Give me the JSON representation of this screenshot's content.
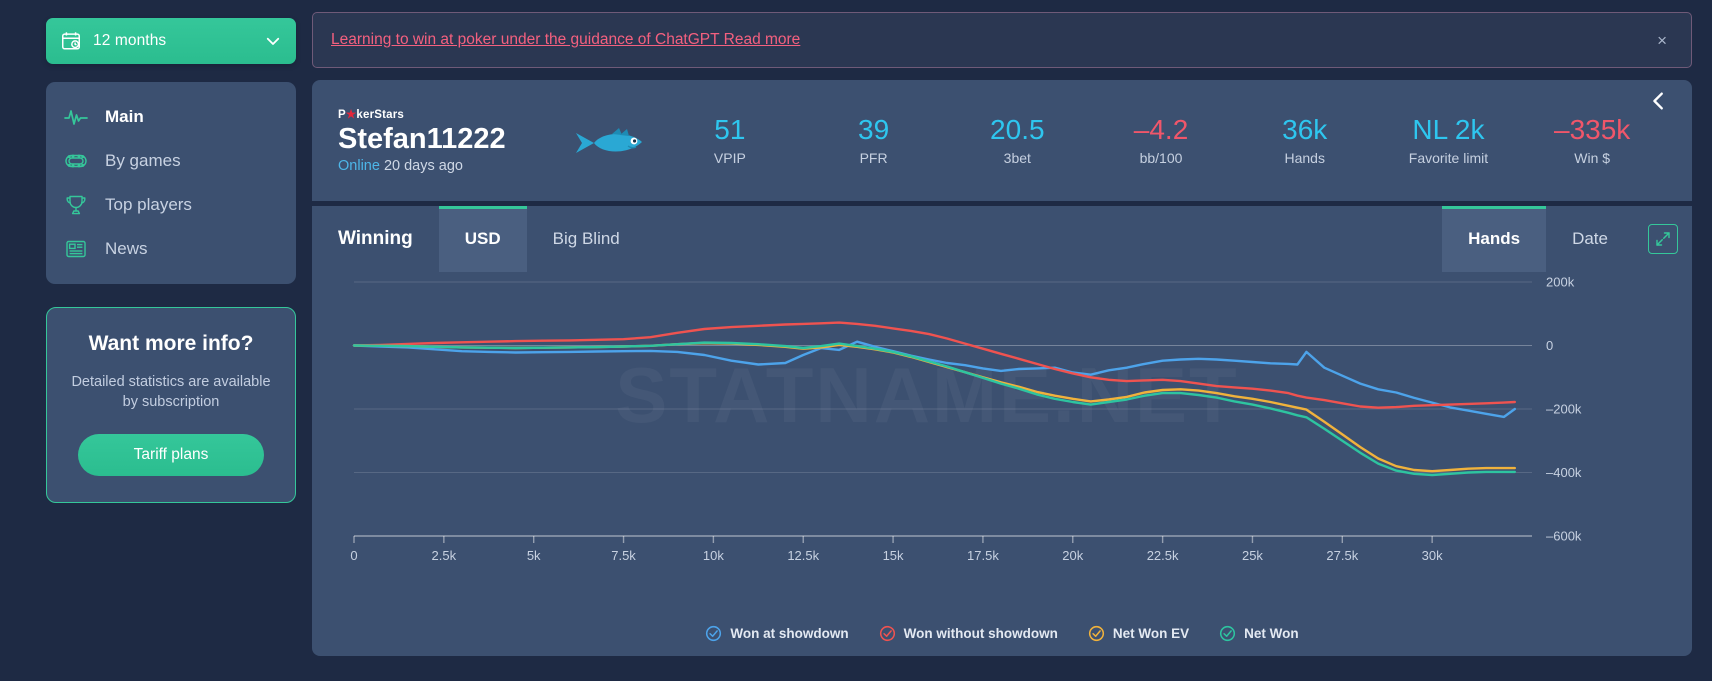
{
  "sidebar": {
    "period_selector": {
      "label": "12 months",
      "icon": "calendar-icon",
      "chevron": "chevron-down-icon"
    },
    "nav": [
      {
        "label": "Main",
        "icon": "pulse-icon",
        "active": true
      },
      {
        "label": "By games",
        "icon": "poker-table-icon",
        "active": false
      },
      {
        "label": "Top players",
        "icon": "trophy-icon",
        "active": false
      },
      {
        "label": "News",
        "icon": "news-icon",
        "active": false
      }
    ],
    "promo": {
      "title": "Want more info?",
      "subtitle": "Detailed statistics are available by subscription",
      "button": "Tariff plans"
    }
  },
  "notice": {
    "link_text": "Learning to win at poker under the guidance of ChatGPT Read more",
    "close": "×",
    "color": "#f4607f"
  },
  "player": {
    "room": "PokerStars",
    "room_prefix": "P",
    "room_suffix": "kerStars",
    "name": "Stefan11222",
    "status_online": "Online",
    "status_rest": "20 days ago",
    "avatar_icon": "fish-icon",
    "collapse_icon": "chevron-left-icon",
    "stats": [
      {
        "value": "51",
        "label": "VPIP",
        "negative": false
      },
      {
        "value": "39",
        "label": "PFR",
        "negative": false
      },
      {
        "value": "20.5",
        "label": "3bet",
        "negative": false
      },
      {
        "value": "–4.2",
        "label": "bb/100",
        "negative": true
      },
      {
        "value": "36k",
        "label": "Hands",
        "negative": false
      },
      {
        "value": "NL 2k",
        "label": "Favorite limit",
        "negative": false
      },
      {
        "value": "–335k",
        "label": "Win $",
        "negative": true
      }
    ]
  },
  "chart_tabs": {
    "heading": "Winning",
    "currency": [
      {
        "label": "USD",
        "active": true
      },
      {
        "label": "Big Blind",
        "active": false
      }
    ],
    "xaxis_mode": [
      {
        "label": "Hands",
        "active": true
      },
      {
        "label": "Date",
        "active": false
      }
    ],
    "expand_icon": "expand-arrows-icon"
  },
  "watermark": "STATNAME.NET",
  "chart_data": {
    "type": "line",
    "title": "",
    "xlabel": "Hands",
    "ylabel": "",
    "xlim": [
      0,
      32500
    ],
    "ylim": [
      -600000,
      200000
    ],
    "xticks": [
      0,
      2500,
      5000,
      7500,
      10000,
      12500,
      15000,
      17500,
      20000,
      22500,
      25000,
      27500,
      30000
    ],
    "xticklabels": [
      "0",
      "2.5k",
      "5k",
      "7.5k",
      "10k",
      "12.5k",
      "15k",
      "17.5k",
      "20k",
      "22.5k",
      "25k",
      "27.5k",
      "30k"
    ],
    "yticks": [
      200000,
      0,
      -200000,
      -400000,
      -600000
    ],
    "yticklabels": [
      "200k",
      "0",
      "–200k",
      "–400k",
      "–600k"
    ],
    "grid": true,
    "legend_position": "bottom",
    "x": [
      0,
      750,
      1500,
      2250,
      3000,
      3750,
      4500,
      5250,
      6000,
      6750,
      7500,
      8250,
      9000,
      9750,
      10500,
      11250,
      12000,
      12500,
      13000,
      13500,
      14000,
      14500,
      15000,
      15500,
      16000,
      16500,
      17000,
      17500,
      18000,
      18500,
      19000,
      19500,
      20000,
      20500,
      21000,
      21500,
      22000,
      22500,
      23000,
      23500,
      24000,
      24500,
      25000,
      25500,
      26000,
      26250,
      26500,
      27000,
      27500,
      28000,
      28500,
      29000,
      29500,
      30000,
      30500,
      31000,
      31500,
      32000,
      32300
    ],
    "series": [
      {
        "name": "Won at showdown",
        "color": "#4da3ea",
        "values": [
          0,
          -3000,
          -6000,
          -12000,
          -18000,
          -20000,
          -22000,
          -21000,
          -20000,
          -19000,
          -18000,
          -17000,
          -20000,
          -30000,
          -48000,
          -60000,
          -55000,
          -30000,
          -8000,
          -14000,
          12000,
          -4000,
          -18000,
          -32000,
          -44000,
          -55000,
          -62000,
          -72000,
          -80000,
          -74000,
          -72000,
          -70000,
          -85000,
          -92000,
          -78000,
          -70000,
          -58000,
          -48000,
          -44000,
          -42000,
          -44000,
          -48000,
          -52000,
          -56000,
          -58000,
          -60000,
          -20000,
          -70000,
          -95000,
          -120000,
          -138000,
          -148000,
          -165000,
          -180000,
          -195000,
          -205000,
          -215000,
          -225000,
          -200000
        ]
      },
      {
        "name": "Won without showdown",
        "color": "#ef5350",
        "values": [
          0,
          2000,
          5000,
          8000,
          10000,
          12000,
          14000,
          15000,
          16000,
          18000,
          20000,
          26000,
          40000,
          52000,
          58000,
          62000,
          66000,
          68000,
          70000,
          72000,
          68000,
          62000,
          54000,
          46000,
          36000,
          22000,
          6000,
          -10000,
          -26000,
          -42000,
          -58000,
          -74000,
          -88000,
          -100000,
          -108000,
          -112000,
          -110000,
          -108000,
          -112000,
          -120000,
          -128000,
          -132000,
          -136000,
          -142000,
          -150000,
          -158000,
          -164000,
          -172000,
          -182000,
          -192000,
          -196000,
          -194000,
          -190000,
          -188000,
          -186000,
          -184000,
          -182000,
          -180000,
          -178000
        ]
      },
      {
        "name": "Net Won EV",
        "color": "#f0b23c",
        "values": [
          0,
          -1000,
          -2000,
          -4000,
          -6000,
          -7000,
          -8000,
          -7000,
          -6000,
          -5000,
          -3000,
          -1000,
          4000,
          8000,
          6000,
          2000,
          -4000,
          -10000,
          -6000,
          2000,
          -4000,
          -12000,
          -22000,
          -36000,
          -52000,
          -68000,
          -84000,
          -100000,
          -116000,
          -130000,
          -146000,
          -158000,
          -168000,
          -176000,
          -170000,
          -162000,
          -148000,
          -140000,
          -138000,
          -142000,
          -150000,
          -160000,
          -168000,
          -178000,
          -190000,
          -196000,
          -202000,
          -240000,
          -280000,
          -320000,
          -356000,
          -380000,
          -392000,
          -396000,
          -392000,
          -388000,
          -386000,
          -386000,
          -386000
        ]
      },
      {
        "name": "Net Won",
        "color": "#2ec4a0",
        "values": [
          0,
          -1000,
          -2000,
          -4000,
          -6000,
          -7000,
          -8000,
          -7000,
          -6000,
          -5000,
          -3000,
          -1000,
          4000,
          9000,
          8000,
          4000,
          -2000,
          -8000,
          -2000,
          6000,
          -2000,
          -10000,
          -20000,
          -34000,
          -50000,
          -66000,
          -84000,
          -102000,
          -120000,
          -136000,
          -154000,
          -168000,
          -178000,
          -186000,
          -178000,
          -170000,
          -158000,
          -150000,
          -150000,
          -156000,
          -164000,
          -176000,
          -186000,
          -198000,
          -212000,
          -220000,
          -226000,
          -262000,
          -300000,
          -338000,
          -372000,
          -394000,
          -404000,
          -408000,
          -404000,
          -400000,
          -398000,
          -398000,
          -398000
        ]
      }
    ]
  }
}
